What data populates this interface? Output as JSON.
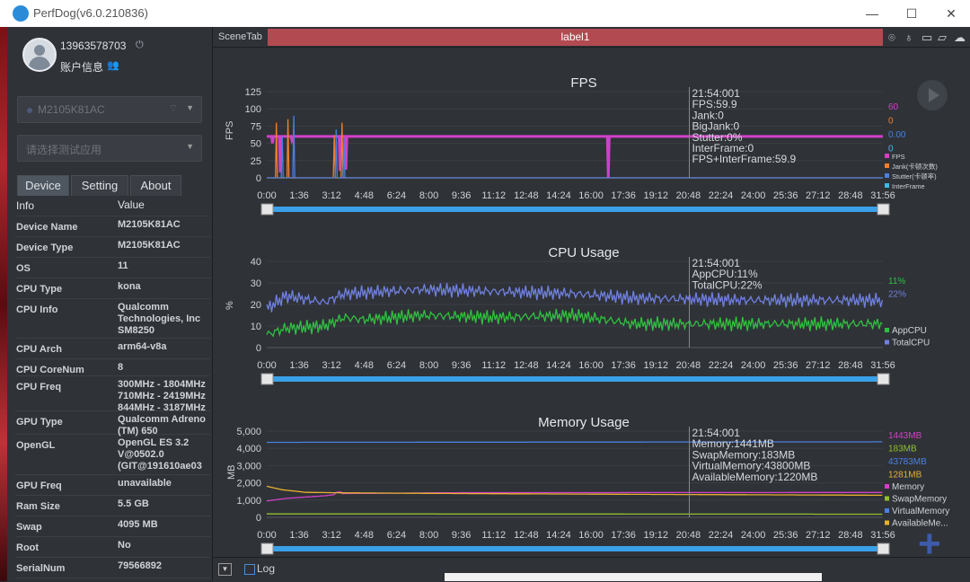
{
  "window": {
    "title": "PerfDog(v6.0.210836)",
    "minimize": "—",
    "maximize": "☐",
    "close": "✕"
  },
  "account": {
    "user_id": "13963578703",
    "power_icon": "⏻",
    "account_label": "账户信息",
    "account_icon": "👥"
  },
  "device_select": {
    "value": "M2105K81AC",
    "arrow": "▼"
  },
  "app_select": {
    "placeholder": "请选择测试应用",
    "arrow": "▼"
  },
  "tabs": [
    {
      "label": "Device"
    },
    {
      "label": "Setting"
    },
    {
      "label": "About"
    }
  ],
  "info_table": {
    "header": {
      "key": "Info",
      "value": "Value"
    },
    "rows": [
      {
        "key": "Device Name",
        "value": "M2105K81AC"
      },
      {
        "key": "Device Type",
        "value": "M2105K81AC"
      },
      {
        "key": "OS",
        "value": "11"
      },
      {
        "key": "CPU Type",
        "value": "kona"
      },
      {
        "key": "CPU Info",
        "value": "Qualcomm Technologies, Inc SM8250"
      },
      {
        "key": "CPU Arch",
        "value": "arm64-v8a"
      },
      {
        "key": "CPU CoreNum",
        "value": "8"
      },
      {
        "key": "CPU Freq",
        "value": "300MHz - 1804MHz 710MHz - 2419MHz 844MHz - 3187MHz"
      },
      {
        "key": "GPU Type",
        "value": "Qualcomm Adreno (TM) 650"
      },
      {
        "key": "OpenGL",
        "value": "OpenGL ES 3.2 V@0502.0 (GIT@191610ae03"
      },
      {
        "key": "GPU Freq",
        "value": "unavailable"
      },
      {
        "key": "Ram Size",
        "value": "5.5 GB"
      },
      {
        "key": "Swap",
        "value": "4095 MB"
      },
      {
        "key": "Root",
        "value": "No"
      },
      {
        "key": "SerialNum",
        "value": "79566892"
      }
    ]
  },
  "scene": {
    "tab_label": "SceneTab",
    "active_label": "label1"
  },
  "bottom": {
    "log_label": "Log",
    "dropdown": "▼"
  },
  "colors": {
    "fps": "#d040c8",
    "jank": "#f08030",
    "bigjank": "#4a80e0",
    "stutter": "#4a80e0",
    "interframe": "#40b8e8",
    "appcpu": "#30c040",
    "totalcpu": "#7080e0",
    "memory": "#d040c8",
    "swap": "#90c030",
    "virtual": "#4a80e0",
    "available": "#e8b030",
    "cursor": "#888888",
    "slider": "#3aa0e8"
  },
  "chart_data": [
    {
      "type": "line",
      "title": "FPS",
      "ylabel": "FPS",
      "ylim": [
        0,
        125
      ],
      "yticks": [
        "0",
        "25",
        "50",
        "75",
        "100",
        "125"
      ],
      "xticks": [
        "0:00",
        "1:36",
        "3:12",
        "4:48",
        "6:24",
        "8:00",
        "9:36",
        "11:12",
        "12:48",
        "14:24",
        "16:00",
        "17:36",
        "19:12",
        "20:48",
        "22:24",
        "24:00",
        "25:36",
        "27:12",
        "28:48",
        "31:56"
      ],
      "cursor_time": "21:54:001",
      "tooltip": [
        "21:54:001",
        "FPS:59.9",
        "Jank:0",
        "BigJank:0",
        "Stutter:0%",
        "InterFrame:0",
        "FPS+InterFrame:59.9"
      ],
      "legend": [
        "FPS",
        "Jank(卡顿次数)",
        "Stutter(卡顿率)",
        "InterFrame"
      ],
      "current_values": [
        "60",
        "0",
        "0.00",
        "0"
      ],
      "series": [
        {
          "name": "FPS",
          "baseline": 60,
          "dips": [
            {
              "t": 0.3,
              "v": 50
            },
            {
              "t": 0.7,
              "v": 8
            },
            {
              "t": 1.3,
              "v": 55
            },
            {
              "t": 3.8,
              "v": 10
            },
            {
              "t": 4.1,
              "v": 12
            },
            {
              "t": 17.7,
              "v": 0
            }
          ]
        },
        {
          "name": "Jank(卡顿次数)",
          "baseline": 0,
          "spikes": [
            {
              "t": 0.5,
              "v": 80
            },
            {
              "t": 1.1,
              "v": 85
            },
            {
              "t": 3.5,
              "v": 62
            },
            {
              "t": 3.9,
              "v": 80
            }
          ]
        },
        {
          "name": "Stutter(卡顿率)",
          "baseline": 0,
          "spikes": [
            {
              "t": 0.8,
              "v": 60
            },
            {
              "t": 1.4,
              "v": 90
            },
            {
              "t": 3.6,
              "v": 70
            },
            {
              "t": 4.0,
              "v": 58
            }
          ]
        }
      ]
    },
    {
      "type": "line",
      "title": "CPU Usage",
      "ylabel": "%",
      "ylim": [
        0,
        40
      ],
      "yticks": [
        "0",
        "10",
        "20",
        "30",
        "40"
      ],
      "xticks": [
        "0:00",
        "1:36",
        "3:12",
        "4:48",
        "6:24",
        "8:00",
        "9:36",
        "11:12",
        "12:48",
        "14:24",
        "16:00",
        "17:36",
        "19:12",
        "20:48",
        "22:24",
        "24:00",
        "25:36",
        "27:12",
        "28:48",
        "31:56"
      ],
      "tooltip": [
        "21:54:001",
        "AppCPU:11%",
        "TotalCPU:22%"
      ],
      "legend": [
        "AppCPU",
        "TotalCPU"
      ],
      "current_values": [
        "11%",
        "22%"
      ],
      "series": [
        {
          "name": "AppCPU",
          "points": [
            [
              0,
              6
            ],
            [
              1,
              9
            ],
            [
              3,
              10
            ],
            [
              4,
              14
            ],
            [
              5,
              13
            ],
            [
              8,
              15
            ],
            [
              12,
              14
            ],
            [
              16,
              15
            ],
            [
              19,
              11
            ],
            [
              31.9,
              11
            ]
          ]
        },
        {
          "name": "TotalCPU",
          "points": [
            [
              0,
              18
            ],
            [
              1,
              24
            ],
            [
              3,
              21
            ],
            [
              4,
              25
            ],
            [
              8,
              27
            ],
            [
              12,
              26
            ],
            [
              16,
              25
            ],
            [
              19,
              23
            ],
            [
              25,
              22
            ],
            [
              31.9,
              22
            ]
          ]
        }
      ]
    },
    {
      "type": "line",
      "title": "Memory Usage",
      "ylabel": "MB",
      "ylim": [
        0,
        5000
      ],
      "yticks": [
        "0",
        "1,000",
        "2,000",
        "3,000",
        "4,000",
        "5,000"
      ],
      "xticks": [
        "0:00",
        "1:36",
        "3:12",
        "4:48",
        "6:24",
        "8:00",
        "9:36",
        "11:12",
        "12:48",
        "14:24",
        "16:00",
        "17:36",
        "19:12",
        "20:48",
        "22:24",
        "24:00",
        "25:36",
        "27:12",
        "28:48",
        "31:56"
      ],
      "tooltip": [
        "21:54:001",
        "Memory:1441MB",
        "SwapMemory:183MB",
        "VirtualMemory:43800MB",
        "AvailableMemory:1220MB"
      ],
      "legend": [
        "Memory",
        "SwapMemory",
        "VirtualMemory",
        "AvailableMe..."
      ],
      "current_values": [
        "1443MB",
        "183MB",
        "43783MB",
        "1281MB"
      ],
      "series": [
        {
          "name": "Memory",
          "points": [
            [
              0,
              950
            ],
            [
              1,
              1100
            ],
            [
              3,
              1250
            ],
            [
              4,
              1380
            ],
            [
              10,
              1430
            ],
            [
              31.9,
              1443
            ]
          ]
        },
        {
          "name": "SwapMemory",
          "points": [
            [
              0,
              200
            ],
            [
              31.9,
              183
            ]
          ]
        },
        {
          "name": "VirtualMemory",
          "points": [
            [
              0,
              4350
            ],
            [
              31.9,
              4378
            ]
          ]
        },
        {
          "name": "AvailableMemory",
          "points": [
            [
              0,
              1800
            ],
            [
              0.8,
              1600
            ],
            [
              2,
              1450
            ],
            [
              4,
              1420
            ],
            [
              10,
              1380
            ],
            [
              20,
              1330
            ],
            [
              31.9,
              1281
            ]
          ]
        }
      ]
    }
  ]
}
